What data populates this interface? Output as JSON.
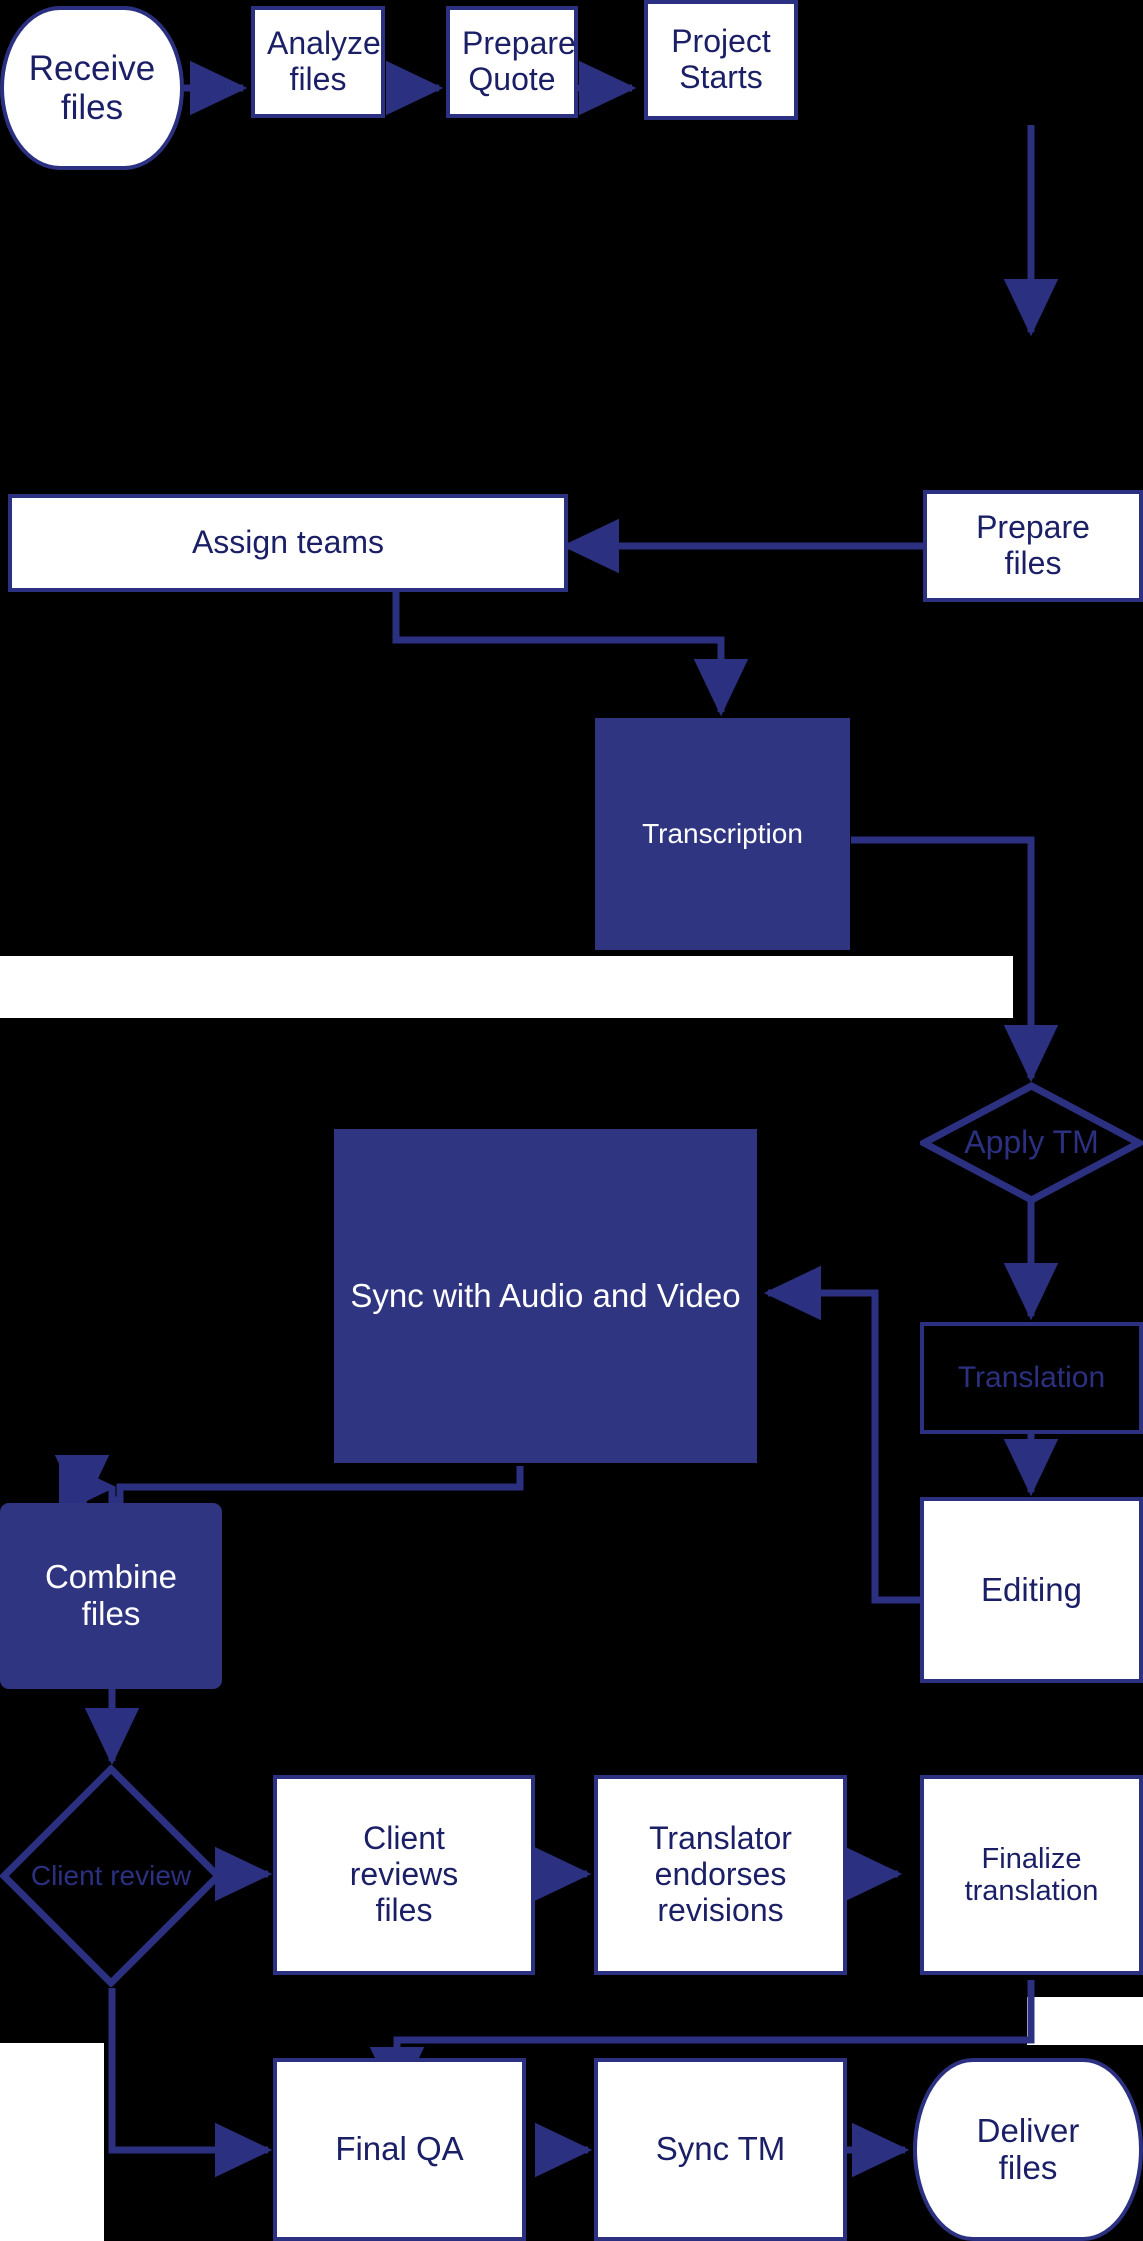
{
  "diagram": {
    "title": "Translation project workflow flowchart",
    "colors": {
      "background": "#000000",
      "stroke": "#2b3180",
      "fill_accent": "#2f3580",
      "node_fill": "#ffffff",
      "text_on_white": "#1b1f66",
      "text_on_fill": "#ffffff"
    },
    "nodes": [
      {
        "id": "receive_files",
        "label": "Receive\nfiles",
        "shape": "terminator",
        "style": "white"
      },
      {
        "id": "analyze_files",
        "label": "Analyze\nfiles",
        "shape": "rect",
        "style": "white"
      },
      {
        "id": "prepare_quote",
        "label": "Prepare\nQuote",
        "shape": "rect",
        "style": "white"
      },
      {
        "id": "project_starts",
        "label": "Project\nStarts",
        "shape": "rect",
        "style": "white"
      },
      {
        "id": "prepare_files",
        "label": "Prepare\nfiles",
        "shape": "rect",
        "style": "white"
      },
      {
        "id": "assign_teams",
        "label": "Assign teams",
        "shape": "rect",
        "style": "white"
      },
      {
        "id": "transcription",
        "label": "Transcription",
        "shape": "rect",
        "style": "filled"
      },
      {
        "id": "apply_tm",
        "label": "Apply\nTM",
        "shape": "decision",
        "style": "open"
      },
      {
        "id": "translation",
        "label": "Translation",
        "shape": "rect",
        "style": "open"
      },
      {
        "id": "sync_audio_video",
        "label": "Sync with Audio and Video",
        "shape": "rect",
        "style": "filled"
      },
      {
        "id": "editing",
        "label": "Editing",
        "shape": "rect",
        "style": "white"
      },
      {
        "id": "combine_files",
        "label": "Combine\nfiles",
        "shape": "roundrect",
        "style": "filled"
      },
      {
        "id": "client_review",
        "label": "Client\nreview",
        "shape": "decision",
        "style": "open"
      },
      {
        "id": "client_reviews_files",
        "label": "Client\nreviews\nfiles",
        "shape": "rect",
        "style": "white"
      },
      {
        "id": "translator_endorses",
        "label": "Translator\nendorses\nrevisions",
        "shape": "rect",
        "style": "white"
      },
      {
        "id": "finalize_translation",
        "label": "Finalize\ntranslation",
        "shape": "rect",
        "style": "white"
      },
      {
        "id": "final_qa",
        "label": "Final QA",
        "shape": "rect",
        "style": "white"
      },
      {
        "id": "sync_tm",
        "label": "Sync TM",
        "shape": "rect",
        "style": "white"
      },
      {
        "id": "deliver_files",
        "label": "Deliver\nfiles",
        "shape": "terminator",
        "style": "white"
      }
    ],
    "edges": [
      {
        "from": "receive_files",
        "to": "analyze_files"
      },
      {
        "from": "analyze_files",
        "to": "prepare_quote"
      },
      {
        "from": "prepare_quote",
        "to": "project_starts"
      },
      {
        "from": "project_starts",
        "to": "prepare_files"
      },
      {
        "from": "prepare_files",
        "to": "assign_teams"
      },
      {
        "from": "assign_teams",
        "to": "transcription"
      },
      {
        "from": "transcription",
        "to": "apply_tm"
      },
      {
        "from": "apply_tm",
        "to": "translation"
      },
      {
        "from": "translation",
        "to": "editing"
      },
      {
        "from": "editing",
        "to": "sync_audio_video"
      },
      {
        "from": "sync_audio_video",
        "to": "combine_files"
      },
      {
        "from": "combine_files",
        "to": "client_review"
      },
      {
        "from": "client_review",
        "to": "client_reviews_files"
      },
      {
        "from": "client_review",
        "to": "final_qa"
      },
      {
        "from": "client_reviews_files",
        "to": "translator_endorses"
      },
      {
        "from": "translator_endorses",
        "to": "finalize_translation"
      },
      {
        "from": "finalize_translation",
        "to": "final_qa"
      },
      {
        "from": "final_qa",
        "to": "sync_tm"
      },
      {
        "from": "sync_tm",
        "to": "deliver_files"
      }
    ],
    "labels": {
      "receive_files": "Receive files",
      "receive_files_l1": "Receive",
      "receive_files_l2": "files",
      "analyze_files_l1": "Analyze",
      "analyze_files_l2": "files",
      "prepare_quote_l1": "Prepare",
      "prepare_quote_l2": "Quote",
      "project_starts_l1": "Project",
      "project_starts_l2": "Starts",
      "prepare_files_l1": "Prepare",
      "prepare_files_l2": "files",
      "assign_teams": "Assign teams",
      "transcription": "Transcription",
      "apply_tm_l1": "Apply",
      "apply_tm_l2": "TM",
      "translation": "Translation",
      "sync_audio_video": "Sync with Audio and Video",
      "editing": "Editing",
      "combine_files_l1": "Combine",
      "combine_files_l2": "files",
      "client_review_l1": "Client",
      "client_review_l2": "review",
      "client_reviews_files_l1": "Client",
      "client_reviews_files_l2": "reviews",
      "client_reviews_files_l3": "files",
      "translator_endorses_l1": "Translator",
      "translator_endorses_l2": "endorses",
      "translator_endorses_l3": "revisions",
      "finalize_translation_l1": "Finalize",
      "finalize_translation_l2": "translation",
      "final_qa": "Final QA",
      "sync_tm": "Sync TM",
      "deliver_files_l1": "Deliver",
      "deliver_files_l2": "files"
    }
  }
}
